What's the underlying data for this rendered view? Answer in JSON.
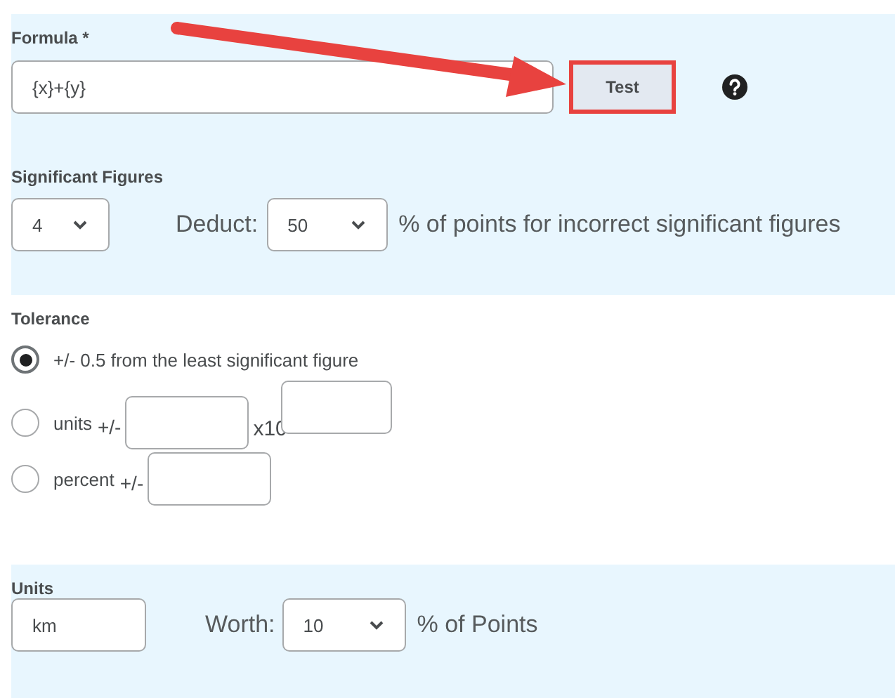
{
  "formula": {
    "label": "Formula *",
    "value": "{x}+{y}",
    "test_button": {
      "label": "Test",
      "highlighted": true
    }
  },
  "significant_figures": {
    "label": "Significant Figures",
    "value": "4",
    "deduct_label": "Deduct:",
    "deduct_value": "50",
    "deduct_suffix": "% of points for incorrect significant figures"
  },
  "tolerance": {
    "label": "Tolerance",
    "options": [
      {
        "kind": "fixed",
        "label": "+/- 0.5 from the least significant figure",
        "selected": true
      },
      {
        "kind": "units",
        "label": "units",
        "suffix": "+/-",
        "multiplier": "x10",
        "selected": false
      },
      {
        "kind": "percent",
        "label": "percent",
        "suffix": "+/-",
        "selected": false
      }
    ]
  },
  "units": {
    "label": "Units",
    "value": "km",
    "worth_label": "Worth:",
    "worth_value": "10",
    "worth_suffix": "% of Points"
  }
}
